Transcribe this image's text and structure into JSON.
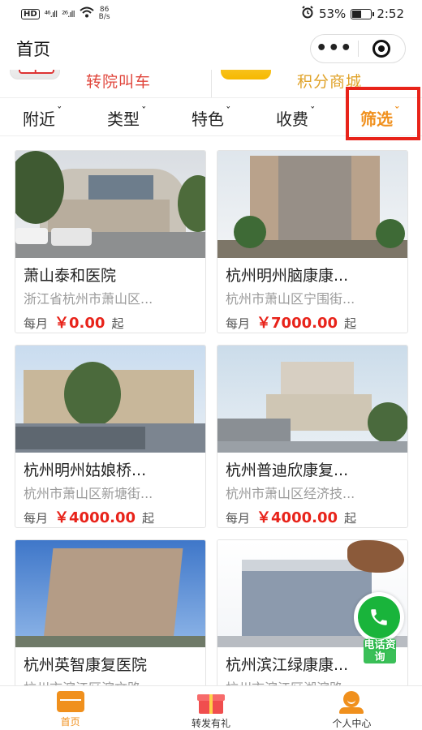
{
  "status": {
    "badge": "HD",
    "sim1": "⁴⁶.ıll",
    "sim2": "²⁶.ıll",
    "speed_value": "86",
    "speed_unit": "B/s",
    "battery": "53%",
    "battery_level": 0.53,
    "time": "2:52"
  },
  "header": {
    "title": "首页"
  },
  "quick_links": [
    {
      "label": "转院叫车",
      "icon": "ambulance-icon"
    },
    {
      "label": "积分商城",
      "icon": "cart-icon"
    }
  ],
  "filters": [
    {
      "label": "附近",
      "active": false
    },
    {
      "label": "类型",
      "active": false
    },
    {
      "label": "特色",
      "active": false
    },
    {
      "label": "收费",
      "active": false
    },
    {
      "label": "筛选",
      "active": true
    }
  ],
  "price_prefix": "每月",
  "price_suffix": "起",
  "cards": [
    {
      "name": "萧山泰和医院",
      "address": "浙江省杭州市萧山区...",
      "price": "￥0.00"
    },
    {
      "name": "杭州明州脑康康...",
      "address": "杭州市萧山区宁围街...",
      "price": "￥7000.00"
    },
    {
      "name": "杭州明州姑娘桥...",
      "address": "杭州市萧山区新塘街...",
      "price": "￥4000.00"
    },
    {
      "name": "杭州普迪欣康复...",
      "address": "杭州市萧山区经济技...",
      "price": "￥4000.00"
    },
    {
      "name": "杭州英智康复医院",
      "address": "杭州市滨江区滨文路...",
      "price": ""
    },
    {
      "name": "杭州滨江绿康康...",
      "address": "杭州市滨江区湖滨路...",
      "price": ""
    }
  ],
  "phone_fab": {
    "label": "电话资询",
    "icon": "phone-icon"
  },
  "tabs": [
    {
      "label": "首页",
      "active": true,
      "icon": "home-icon"
    },
    {
      "label": "转发有礼",
      "active": false,
      "icon": "gift-icon"
    },
    {
      "label": "个人中心",
      "active": false,
      "icon": "user-icon"
    }
  ],
  "colors": {
    "accent": "#f0901d",
    "price": "#e8231a",
    "highlight_box": "#e8231a",
    "phone": "#19b43b"
  }
}
